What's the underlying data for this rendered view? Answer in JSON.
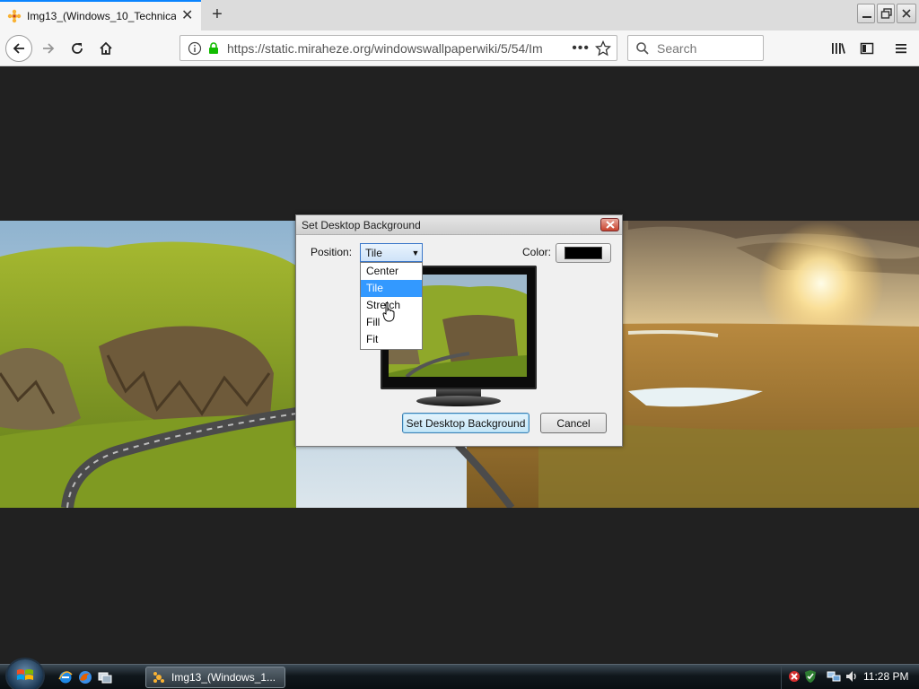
{
  "browser": {
    "tab_title": "Img13_(Windows_10_Technical",
    "url": "https://static.miraheze.org/windowswallpaperwiki/5/54/Im",
    "search_placeholder": "Search"
  },
  "dialog": {
    "title": "Set Desktop Background",
    "position_label": "Position:",
    "position_value": "Tile",
    "color_label": "Color:",
    "color_value": "#000000",
    "options": [
      "Center",
      "Tile",
      "Stretch",
      "Fill",
      "Fit"
    ],
    "highlighted_option": "Tile",
    "set_button": "Set Desktop Background",
    "cancel_button": "Cancel"
  },
  "taskbar": {
    "task_label": "Img13_(Windows_1...",
    "clock": "11:28 PM"
  },
  "colors": {
    "accent": "#0a84ff",
    "selection": "#3399ff",
    "page_background": "#212121"
  },
  "icons": [
    "firefox-favicon",
    "close-icon",
    "plus-icon",
    "minimize-icon",
    "restore-icon",
    "back-icon",
    "forward-icon",
    "reload-icon",
    "home-icon",
    "info-icon",
    "lock-icon",
    "page-actions-icon",
    "star-icon",
    "search-icon",
    "library-icon",
    "sidebar-icon",
    "hamburger-menu-icon",
    "windows-logo-icon",
    "ie-icon",
    "firefox-icon",
    "show-desktop-icon",
    "security-x-icon",
    "shield-icon",
    "network-icon",
    "volume-icon"
  ]
}
